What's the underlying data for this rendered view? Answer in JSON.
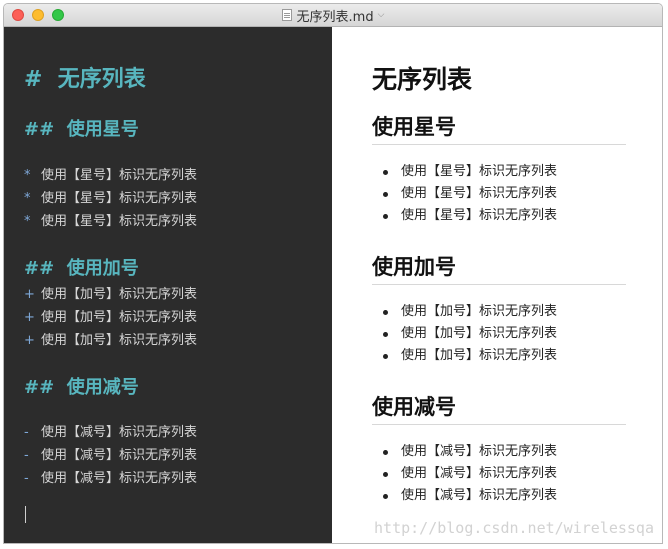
{
  "window": {
    "title": "无序列表.md",
    "dropdown_glyph": "⌵"
  },
  "editor": {
    "h1": "#  无序列表",
    "sections": [
      {
        "heading": "##  使用星号",
        "marker": "*",
        "items": [
          "使用【星号】标识无序列表",
          "使用【星号】标识无序列表",
          "使用【星号】标识无序列表"
        ]
      },
      {
        "heading": "##  使用加号",
        "marker": "+",
        "items": [
          "使用【加号】标识无序列表",
          "使用【加号】标识无序列表",
          "使用【加号】标识无序列表"
        ]
      },
      {
        "heading": "##  使用减号",
        "marker": "-",
        "items": [
          "使用【减号】标识无序列表",
          "使用【减号】标识无序列表",
          "使用【减号】标识无序列表"
        ]
      }
    ]
  },
  "preview": {
    "h1": "无序列表",
    "sections": [
      {
        "heading": "使用星号",
        "items": [
          "使用【星号】标识无序列表",
          "使用【星号】标识无序列表",
          "使用【星号】标识无序列表"
        ]
      },
      {
        "heading": "使用加号",
        "items": [
          "使用【加号】标识无序列表",
          "使用【加号】标识无序列表",
          "使用【加号】标识无序列表"
        ]
      },
      {
        "heading": "使用减号",
        "items": [
          "使用【减号】标识无序列表",
          "使用【减号】标识无序列表",
          "使用【减号】标识无序列表"
        ]
      }
    ],
    "watermark": "http://blog.csdn.net/wirelessqa"
  }
}
